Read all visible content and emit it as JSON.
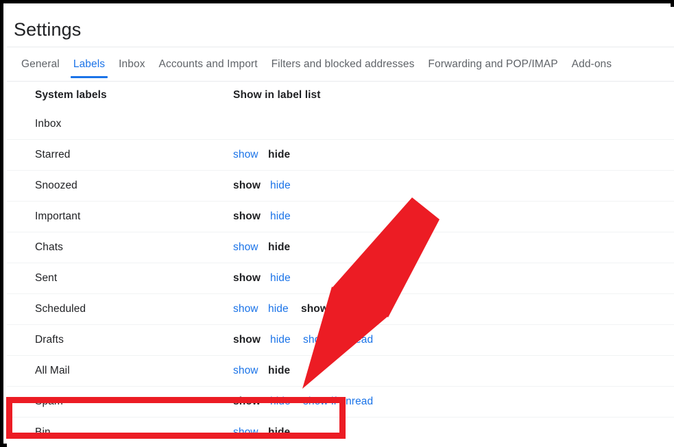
{
  "window": {
    "title": "Settings",
    "frame_color": "#000000"
  },
  "tabs": [
    {
      "label": "General",
      "active": false
    },
    {
      "label": "Labels",
      "active": true
    },
    {
      "label": "Inbox",
      "active": false
    },
    {
      "label": "Accounts and Import",
      "active": false
    },
    {
      "label": "Filters and blocked addresses",
      "active": false
    },
    {
      "label": "Forwarding and POP/IMAP",
      "active": false
    },
    {
      "label": "Add-ons",
      "active": false
    }
  ],
  "table": {
    "headers": {
      "labels_column": "System labels",
      "actions_column": "Show in label list"
    },
    "rows": [
      {
        "label": "Inbox",
        "actions": []
      },
      {
        "label": "Starred",
        "actions": [
          {
            "text": "show",
            "state": "link"
          },
          {
            "text": "hide",
            "state": "current"
          }
        ]
      },
      {
        "label": "Snoozed",
        "actions": [
          {
            "text": "show",
            "state": "current"
          },
          {
            "text": "hide",
            "state": "link"
          }
        ]
      },
      {
        "label": "Important",
        "actions": [
          {
            "text": "show",
            "state": "current"
          },
          {
            "text": "hide",
            "state": "link"
          }
        ]
      },
      {
        "label": "Chats",
        "actions": [
          {
            "text": "show",
            "state": "link"
          },
          {
            "text": "hide",
            "state": "current"
          }
        ]
      },
      {
        "label": "Sent",
        "actions": [
          {
            "text": "show",
            "state": "current"
          },
          {
            "text": "hide",
            "state": "link"
          }
        ]
      },
      {
        "label": "Scheduled",
        "actions": [
          {
            "text": "show",
            "state": "link"
          },
          {
            "text": "hide",
            "state": "link"
          },
          {
            "text": "show if unread",
            "state": "current"
          }
        ]
      },
      {
        "label": "Drafts",
        "actions": [
          {
            "text": "show",
            "state": "current"
          },
          {
            "text": "hide",
            "state": "link"
          },
          {
            "text": "show if unread",
            "state": "link"
          }
        ]
      },
      {
        "label": "All Mail",
        "actions": [
          {
            "text": "show",
            "state": "link"
          },
          {
            "text": "hide",
            "state": "current"
          }
        ]
      },
      {
        "label": "Spam",
        "actions": [
          {
            "text": "show",
            "state": "current"
          },
          {
            "text": "hide",
            "state": "link"
          },
          {
            "text": "show if unread",
            "state": "link"
          }
        ]
      },
      {
        "label": "Bin",
        "actions": [
          {
            "text": "show",
            "state": "link"
          },
          {
            "text": "hide",
            "state": "current"
          }
        ]
      }
    ]
  },
  "annotations": {
    "color": "#ec1c24",
    "highlight": {
      "target_row_label": "Bin"
    },
    "arrow": {
      "points_to_row_label": "Spam",
      "points_to_action": "show if unread"
    }
  }
}
